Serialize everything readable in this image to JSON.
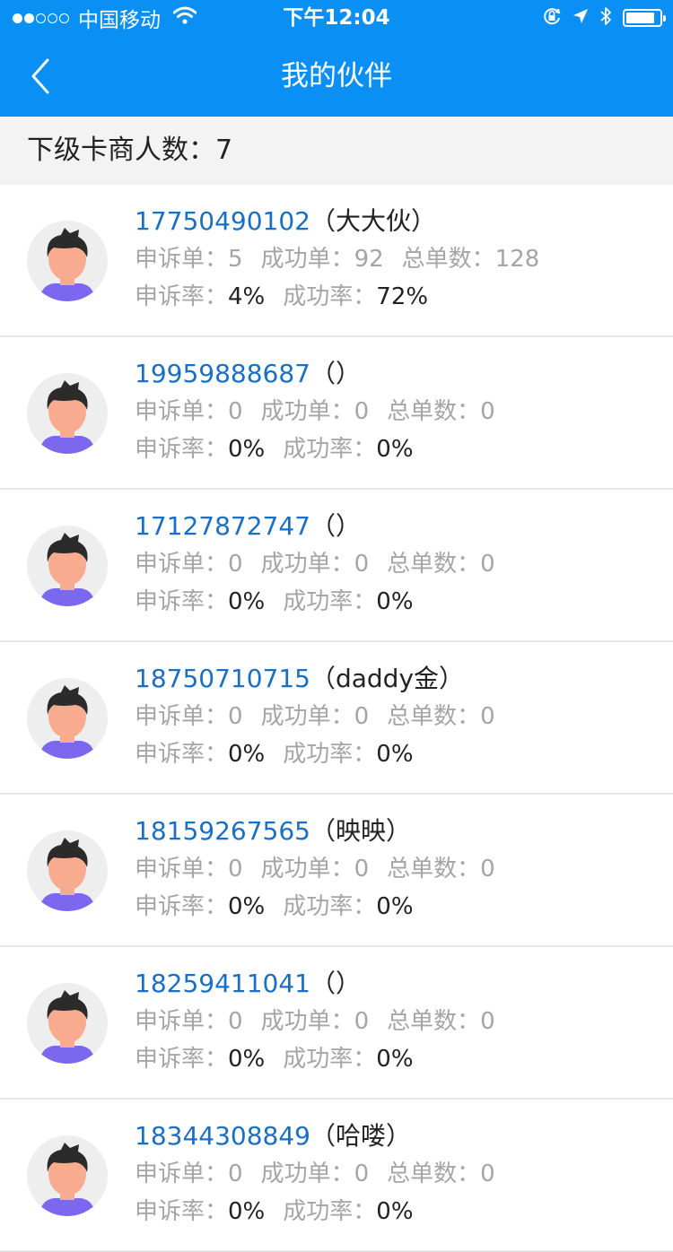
{
  "status_bar": {
    "carrier": "中国移动",
    "time": "下午12:04",
    "signal_bars": 2,
    "battery_level": 0.85
  },
  "nav": {
    "title": "我的伙伴"
  },
  "summary": {
    "label": "下级卡商人数：",
    "count": "7"
  },
  "labels": {
    "complaint_orders": "申诉单：",
    "success_orders": "成功单：",
    "total_orders": "总单数：",
    "complaint_rate": "申诉率：",
    "success_rate": "成功率："
  },
  "partners": [
    {
      "phone": "17750490102",
      "nickname": "（大大伙）",
      "complaint_orders": "5",
      "success_orders": "92",
      "total_orders": "128",
      "complaint_rate": "4%",
      "success_rate": "72%"
    },
    {
      "phone": "19959888687",
      "nickname": "（）",
      "complaint_orders": "0",
      "success_orders": "0",
      "total_orders": "0",
      "complaint_rate": "0%",
      "success_rate": "0%"
    },
    {
      "phone": "17127872747",
      "nickname": "（）",
      "complaint_orders": "0",
      "success_orders": "0",
      "total_orders": "0",
      "complaint_rate": "0%",
      "success_rate": "0%"
    },
    {
      "phone": "18750710715",
      "nickname": "（daddy金）",
      "complaint_orders": "0",
      "success_orders": "0",
      "total_orders": "0",
      "complaint_rate": "0%",
      "success_rate": "0%"
    },
    {
      "phone": "18159267565",
      "nickname": "（映映）",
      "complaint_orders": "0",
      "success_orders": "0",
      "total_orders": "0",
      "complaint_rate": "0%",
      "success_rate": "0%"
    },
    {
      "phone": "18259411041",
      "nickname": "（）",
      "complaint_orders": "0",
      "success_orders": "0",
      "total_orders": "0",
      "complaint_rate": "0%",
      "success_rate": "0%"
    },
    {
      "phone": "18344308849",
      "nickname": "（哈喽）",
      "complaint_orders": "0",
      "success_orders": "0",
      "total_orders": "0",
      "complaint_rate": "0%",
      "success_rate": "0%"
    }
  ],
  "colors": {
    "header_bg": "#0a8ff5",
    "phone_text": "#1a6fc4",
    "muted_text": "#a5a5a5",
    "avatar_shirt": "#7b68ee",
    "avatar_skin": "#f9ab8f"
  }
}
